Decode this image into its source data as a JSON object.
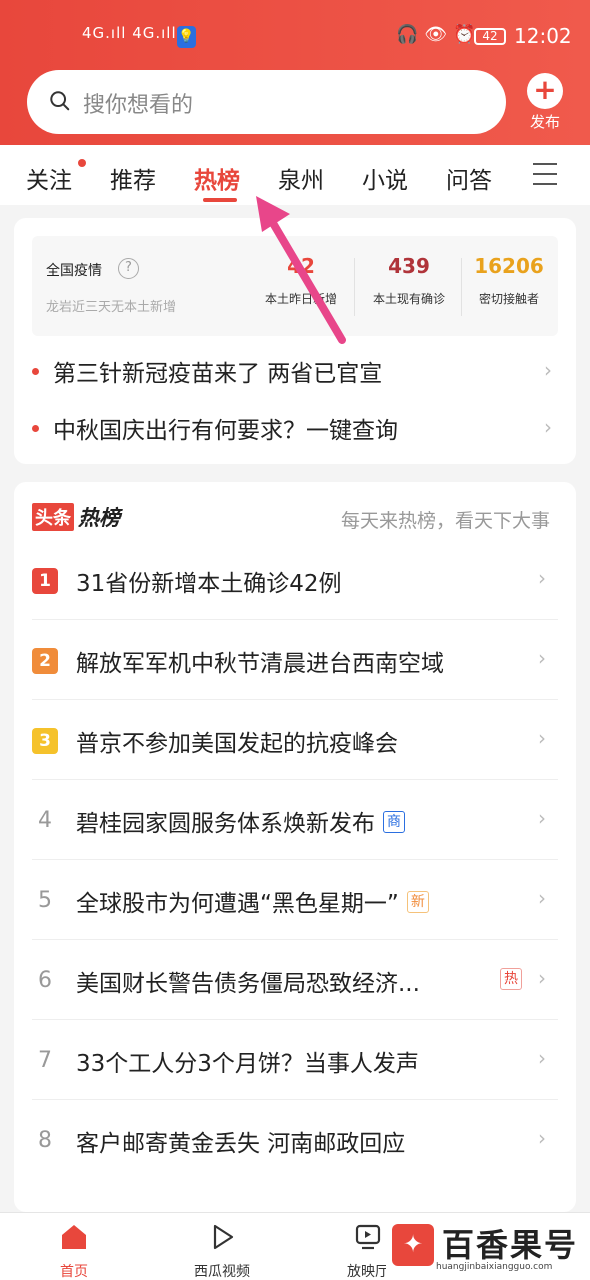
{
  "status": {
    "network": "4G.ıll 4G.ıll",
    "battery": "42",
    "time": "12:02"
  },
  "search": {
    "placeholder": "搜你想看的"
  },
  "publish": {
    "label": "发布"
  },
  "tabs": [
    {
      "label": "关注"
    },
    {
      "label": "推荐"
    },
    {
      "label": "热榜"
    },
    {
      "label": "泉州"
    },
    {
      "label": "小说"
    },
    {
      "label": "问答"
    }
  ],
  "epidemic": {
    "title": "全国疫情",
    "help": "?",
    "subtitle": "龙岩近三天无本土新增",
    "stats": [
      {
        "value": "42",
        "label": "本土昨日新增",
        "color": "#e8473c"
      },
      {
        "value": "439",
        "label": "本土现有确诊",
        "color": "#b0343a"
      },
      {
        "value": "16206",
        "label": "密切接触者",
        "color": "#e9a21d"
      }
    ]
  },
  "top_news": [
    {
      "title": "第三针新冠疫苗来了 两省已官宣"
    },
    {
      "title": "中秋国庆出行有何要求？一键查询"
    }
  ],
  "hot": {
    "logo_a": "头条",
    "logo_b": "热榜",
    "slogan": "每天来热榜，看天下大事",
    "items": [
      {
        "rank": "1",
        "title": "31省份新增本土确诊42例",
        "badge": ""
      },
      {
        "rank": "2",
        "title": "解放军军机中秋节清晨进台西南空域",
        "badge": ""
      },
      {
        "rank": "3",
        "title": "普京不参加美国发起的抗疫峰会",
        "badge": ""
      },
      {
        "rank": "4",
        "title": "碧桂园家圆服务体系焕新发布",
        "badge": "商"
      },
      {
        "rank": "5",
        "title": "全球股市为何遭遇“黑色星期一”",
        "badge": "新"
      },
      {
        "rank": "6",
        "title": "美国财长警告债务僵局恐致经济...",
        "badge": "热"
      },
      {
        "rank": "7",
        "title": "33个工人分3个月饼？当事人发声",
        "badge": ""
      },
      {
        "rank": "8",
        "title": "客户邮寄黄金丢失 河南邮政回应",
        "badge": ""
      }
    ]
  },
  "bottom_nav": [
    {
      "label": "首页",
      "icon": "home-icon"
    },
    {
      "label": "西瓜视频",
      "icon": "play-icon"
    },
    {
      "label": "放映厅",
      "icon": "screen-icon"
    }
  ],
  "watermark": {
    "name": "百香果号",
    "url": "huangjinbaixiangguo.com"
  },
  "colors": {
    "brand": "#e8473c",
    "rank1": "#e8473c",
    "rank2": "#f08c3a",
    "rank3": "#f5c22b"
  }
}
